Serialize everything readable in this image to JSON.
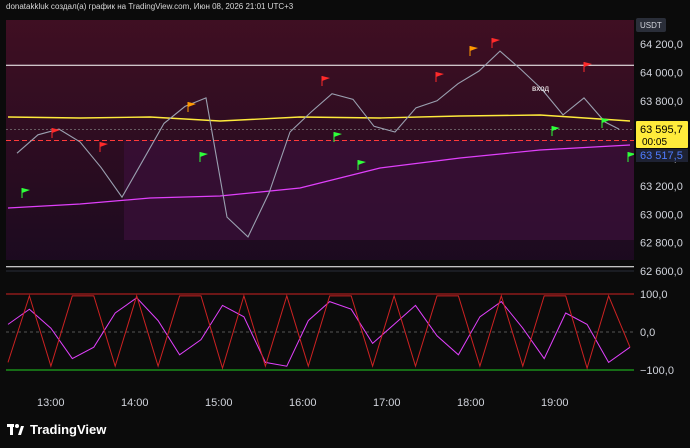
{
  "header": {
    "caption": "donatakkluk создал(а) график на TradingView.com, Июн 08, 2026 21:01 UTC+3"
  },
  "currency_label": "USDT",
  "colors": {
    "background": "#0b0b0b",
    "band_red": "#5a1030",
    "band_purple": "#3a1040",
    "price": "#9aa0b0",
    "ma_yellow": "#ffeb3b",
    "ma_magenta": "#e040fb",
    "flag_red": "#ff2a2a",
    "flag_orange": "#ff9800",
    "flag_green": "#2eff3a",
    "label_last_bg": "#ffeb3b",
    "label_second_bg": "#1e2233"
  },
  "chart_data": [
    {
      "type": "line",
      "title": "",
      "xlabel": "",
      "ylabel": "",
      "x_ticks": [
        "13:00",
        "14:00",
        "15:00",
        "16:00",
        "17:00",
        "18:00",
        "19:00"
      ],
      "y_ticks": [
        "64 200,0",
        "64 000,0",
        "63 800,0",
        "63 600,0",
        "63 400,0",
        "63 200,0",
        "63 000,0",
        "62 800,0",
        "62 600,0"
      ],
      "ylim": [
        62580,
        64300
      ],
      "series": [
        {
          "name": "",
          "x": [
            "12:35",
            "12:50",
            "13:05",
            "13:20",
            "13:35",
            "13:50",
            "14:05",
            "14:20",
            "14:35",
            "14:50",
            "15:05",
            "15:20",
            "15:35",
            "15:50",
            "16:05",
            "16:20",
            "16:35",
            "16:50",
            "17:05",
            "17:20",
            "17:35",
            "17:50",
            "18:05",
            "18:20",
            "18:35",
            "18:50",
            "19:05",
            "19:20",
            "19:35",
            "19:45"
          ],
          "values": [
            63430,
            63560,
            63600,
            63510,
            63330,
            63120,
            63380,
            63640,
            63760,
            63820,
            62980,
            62840,
            63150,
            63580,
            63720,
            63850,
            63810,
            63620,
            63580,
            63750,
            63800,
            63920,
            64010,
            64150,
            64020,
            63880,
            63700,
            63820,
            63650,
            63600
          ]
        }
      ],
      "annotations": {
        "last_price": "63 595,7",
        "countdown": "00:05",
        "second_price": "63 517,5",
        "entry_label": "вход"
      }
    },
    {
      "type": "line",
      "title": "",
      "y_ticks": [
        "100,0",
        "0,0",
        "−100,0"
      ],
      "ylim": [
        -120,
        120
      ],
      "series": [
        {
          "name": "",
          "values": [
            20,
            60,
            10,
            -70,
            -40,
            50,
            90,
            30,
            -60,
            -20,
            70,
            40,
            -80,
            -90,
            30,
            80,
            60,
            -30,
            20,
            70,
            -10,
            -60,
            40,
            80,
            10,
            -70,
            50,
            20,
            -80,
            -40
          ]
        },
        {
          "name": "",
          "values": [
            -80,
            95,
            -90,
            95,
            95,
            -90,
            95,
            -90,
            95,
            95,
            -95,
            95,
            -90,
            95,
            -90,
            95,
            95,
            -90,
            95,
            -90,
            95,
            95,
            -90,
            95,
            -90,
            95,
            95,
            -95,
            95,
            -40
          ]
        }
      ]
    }
  ]
}
